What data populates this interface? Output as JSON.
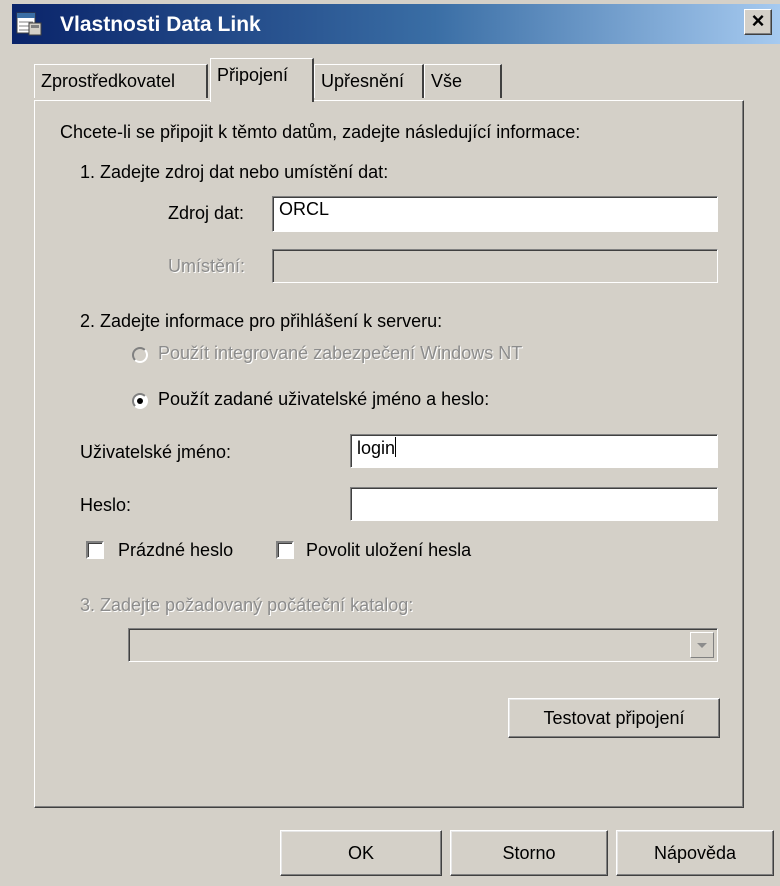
{
  "window": {
    "title": "Vlastnosti Data Link",
    "close_label": "×"
  },
  "tabs": [
    {
      "label": "Zprostředkovatel",
      "active": false
    },
    {
      "label": "Připojení",
      "active": true
    },
    {
      "label": "Upřesnění",
      "active": false
    },
    {
      "label": "Vše",
      "active": false
    }
  ],
  "intro": "Chcete-li se připojit k těmto datům, zadejte následující informace:",
  "step1": {
    "heading": "1. Zadejte zdroj dat nebo umístění dat:",
    "source_label": "Zdroj dat:",
    "source_value": "ORCL",
    "location_label": "Umístění:",
    "location_value": ""
  },
  "step2": {
    "heading": "2. Zadejte informace pro přihlášení k serveru:",
    "radio_integrated": "Použít integrované zabezpečení Windows NT",
    "radio_specific": "Použít zadané uživatelské jméno a heslo:",
    "username_label": "Uživatelské jméno:",
    "username_value": "login",
    "password_label": "Heslo:",
    "password_value": "",
    "blank_password": "Prázdné heslo",
    "allow_saving": "Povolit uložení hesla"
  },
  "step3": {
    "heading": "3. Zadejte požadovaný počáteční katalog:",
    "catalog_value": ""
  },
  "buttons": {
    "test": "Testovat připojení",
    "ok": "OK",
    "cancel": "Storno",
    "help": "Nápověda"
  },
  "colors": {
    "title_start": "#0a246a",
    "title_end": "#a6caf0",
    "face": "#d4d0c8"
  }
}
